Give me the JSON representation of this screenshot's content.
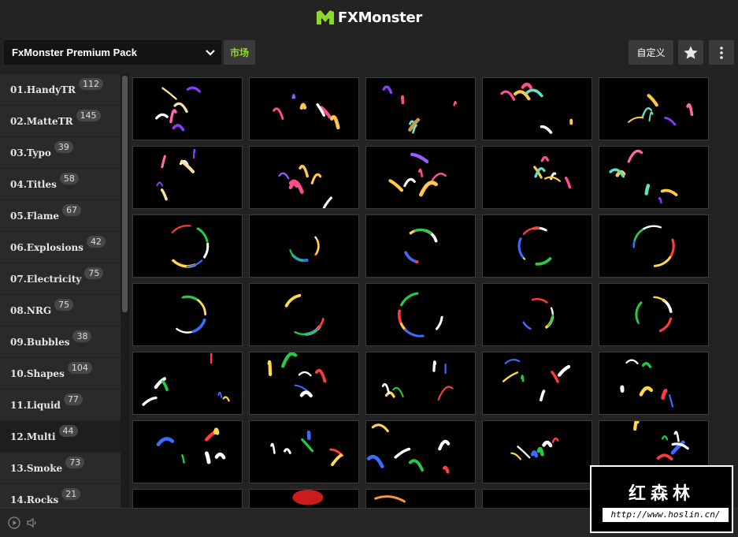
{
  "header": {
    "brand": "FXMonster",
    "brand_color": "#8dd82a"
  },
  "toolbar": {
    "pack": "FxMonster Premium Pack",
    "market_label": "市场",
    "custom_label": "自定义"
  },
  "sidebar": {
    "items": [
      {
        "label": "01.HandyTR",
        "count": "112"
      },
      {
        "label": "02.MatteTR",
        "count": "145"
      },
      {
        "label": "03.Typo",
        "count": "39"
      },
      {
        "label": "04.Titles",
        "count": "58"
      },
      {
        "label": "05.Flame",
        "count": "67"
      },
      {
        "label": "06.Explosions",
        "count": "42"
      },
      {
        "label": "07.Electricity",
        "count": "75"
      },
      {
        "label": "08.NRG",
        "count": "75"
      },
      {
        "label": "09.Bubbles",
        "count": "38"
      },
      {
        "label": "10.Shapes",
        "count": "104"
      },
      {
        "label": "11.Liquid",
        "count": "77"
      },
      {
        "label": "12.Multi",
        "count": "44"
      },
      {
        "label": "13.Smoke",
        "count": "73"
      },
      {
        "label": "14.Rocks",
        "count": "21"
      }
    ],
    "active_index": 11
  },
  "watermark": {
    "title": "红森林",
    "url": "http://www.hoslin.cn/"
  }
}
